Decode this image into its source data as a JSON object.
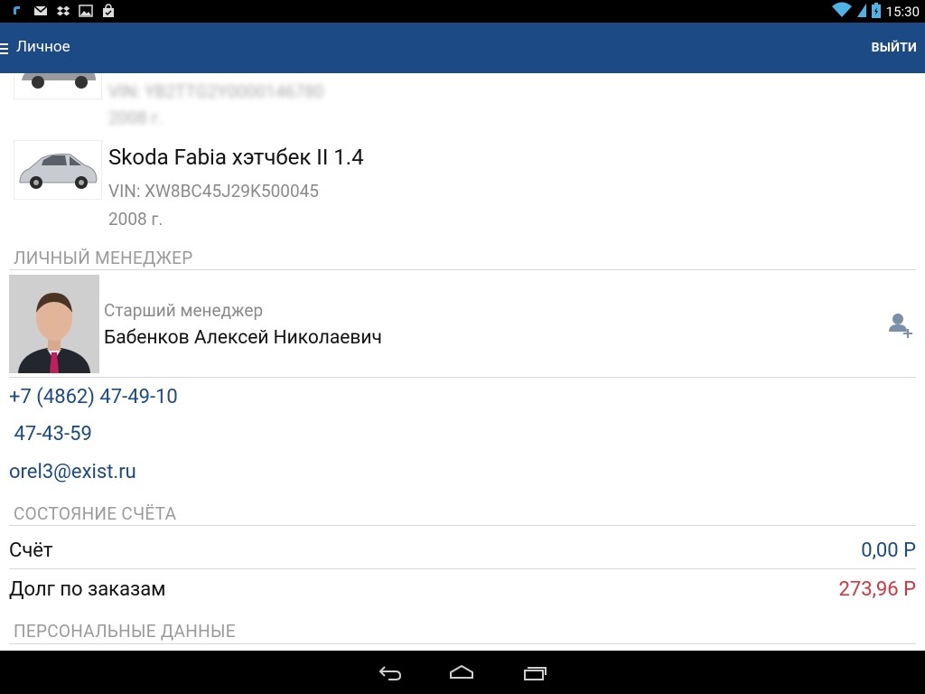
{
  "status_bar": {
    "left_icons": [
      "chat-bubble-icon",
      "gmail-icon",
      "dropbox-icon",
      "gallery-icon",
      "shopping-bag-icon"
    ],
    "time": "15:30"
  },
  "app_bar": {
    "title": "Личное",
    "logout_label": "ВЫЙТИ"
  },
  "cars": [
    {
      "title": "",
      "vin": "VIN: YB2TTG2Y0000146780",
      "year": "2008 г."
    },
    {
      "title": "Skoda Fabia хэтчбек II 1.4",
      "vin": "VIN: XW8BC45J29K500045",
      "year": "2008 г."
    }
  ],
  "manager": {
    "section_title": "ЛИЧНЫЙ МЕНЕДЖЕР",
    "role": "Старший менеджер",
    "name": "Бабенков Алексей Николаевич",
    "phone_primary": "+7 (4862) 47-49-10",
    "phone_secondary": " 47-43-59",
    "email": "orel3@exist.ru"
  },
  "account": {
    "section_title": "СОСТОЯНИЕ СЧЁТА",
    "rows": [
      {
        "label": "Счёт",
        "value": "0,00 Р",
        "color": "#1b4a85"
      },
      {
        "label": "Долг по заказам",
        "value": "273,96 Р",
        "color": "#d9343b"
      }
    ]
  },
  "personal": {
    "section_title": "ПЕРСОНАЛЬНЫЕ ДАННЫЕ"
  },
  "colors": {
    "app_bar": "#1b4a85",
    "link": "#1b4a85",
    "debt": "#d9343b"
  }
}
